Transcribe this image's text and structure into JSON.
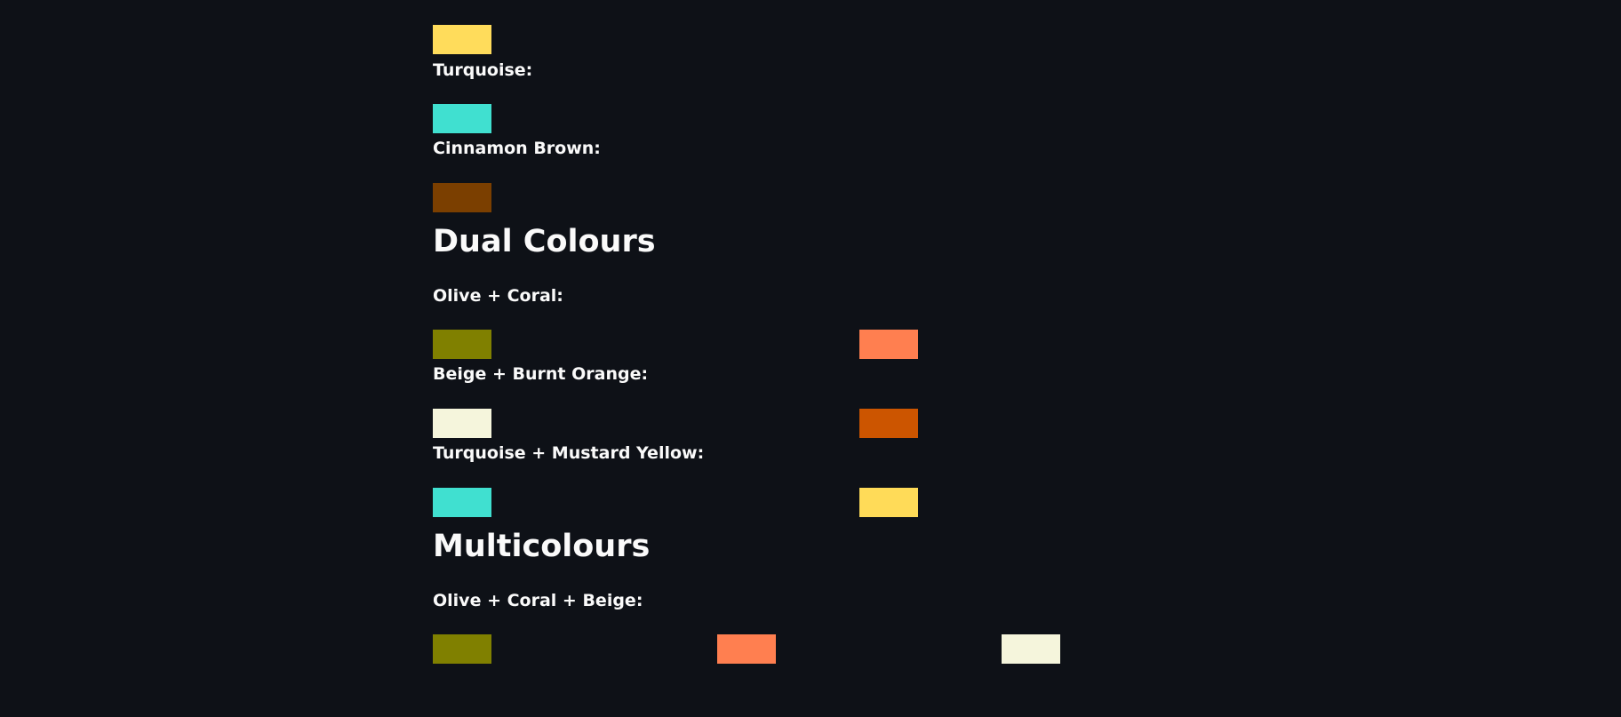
{
  "single": {
    "top_swatch": {
      "color": "#ffdc5b"
    },
    "turquoise": {
      "label": "Turquoise:",
      "color": "#40e0d0"
    },
    "cinnamon": {
      "label": "Cinnamon Brown:",
      "color": "#7b3f00"
    }
  },
  "dual": {
    "heading": "Dual Colours",
    "olive_coral": {
      "label": "Olive + Coral:",
      "colors": [
        "#808000",
        "#ff7f50"
      ]
    },
    "beige_orange": {
      "label": "Beige + Burnt Orange:",
      "colors": [
        "#f5f5dc",
        "#cc5500"
      ]
    },
    "turquoise_mustard": {
      "label": "Turquoise + Mustard Yellow:",
      "colors": [
        "#40e0d0",
        "#ffdb58"
      ]
    }
  },
  "multi": {
    "heading": "Multicolours",
    "olive_coral_beige": {
      "label": "Olive + Coral + Beige:",
      "colors": [
        "#808000",
        "#ff7f50",
        "#f5f5dc"
      ]
    }
  }
}
